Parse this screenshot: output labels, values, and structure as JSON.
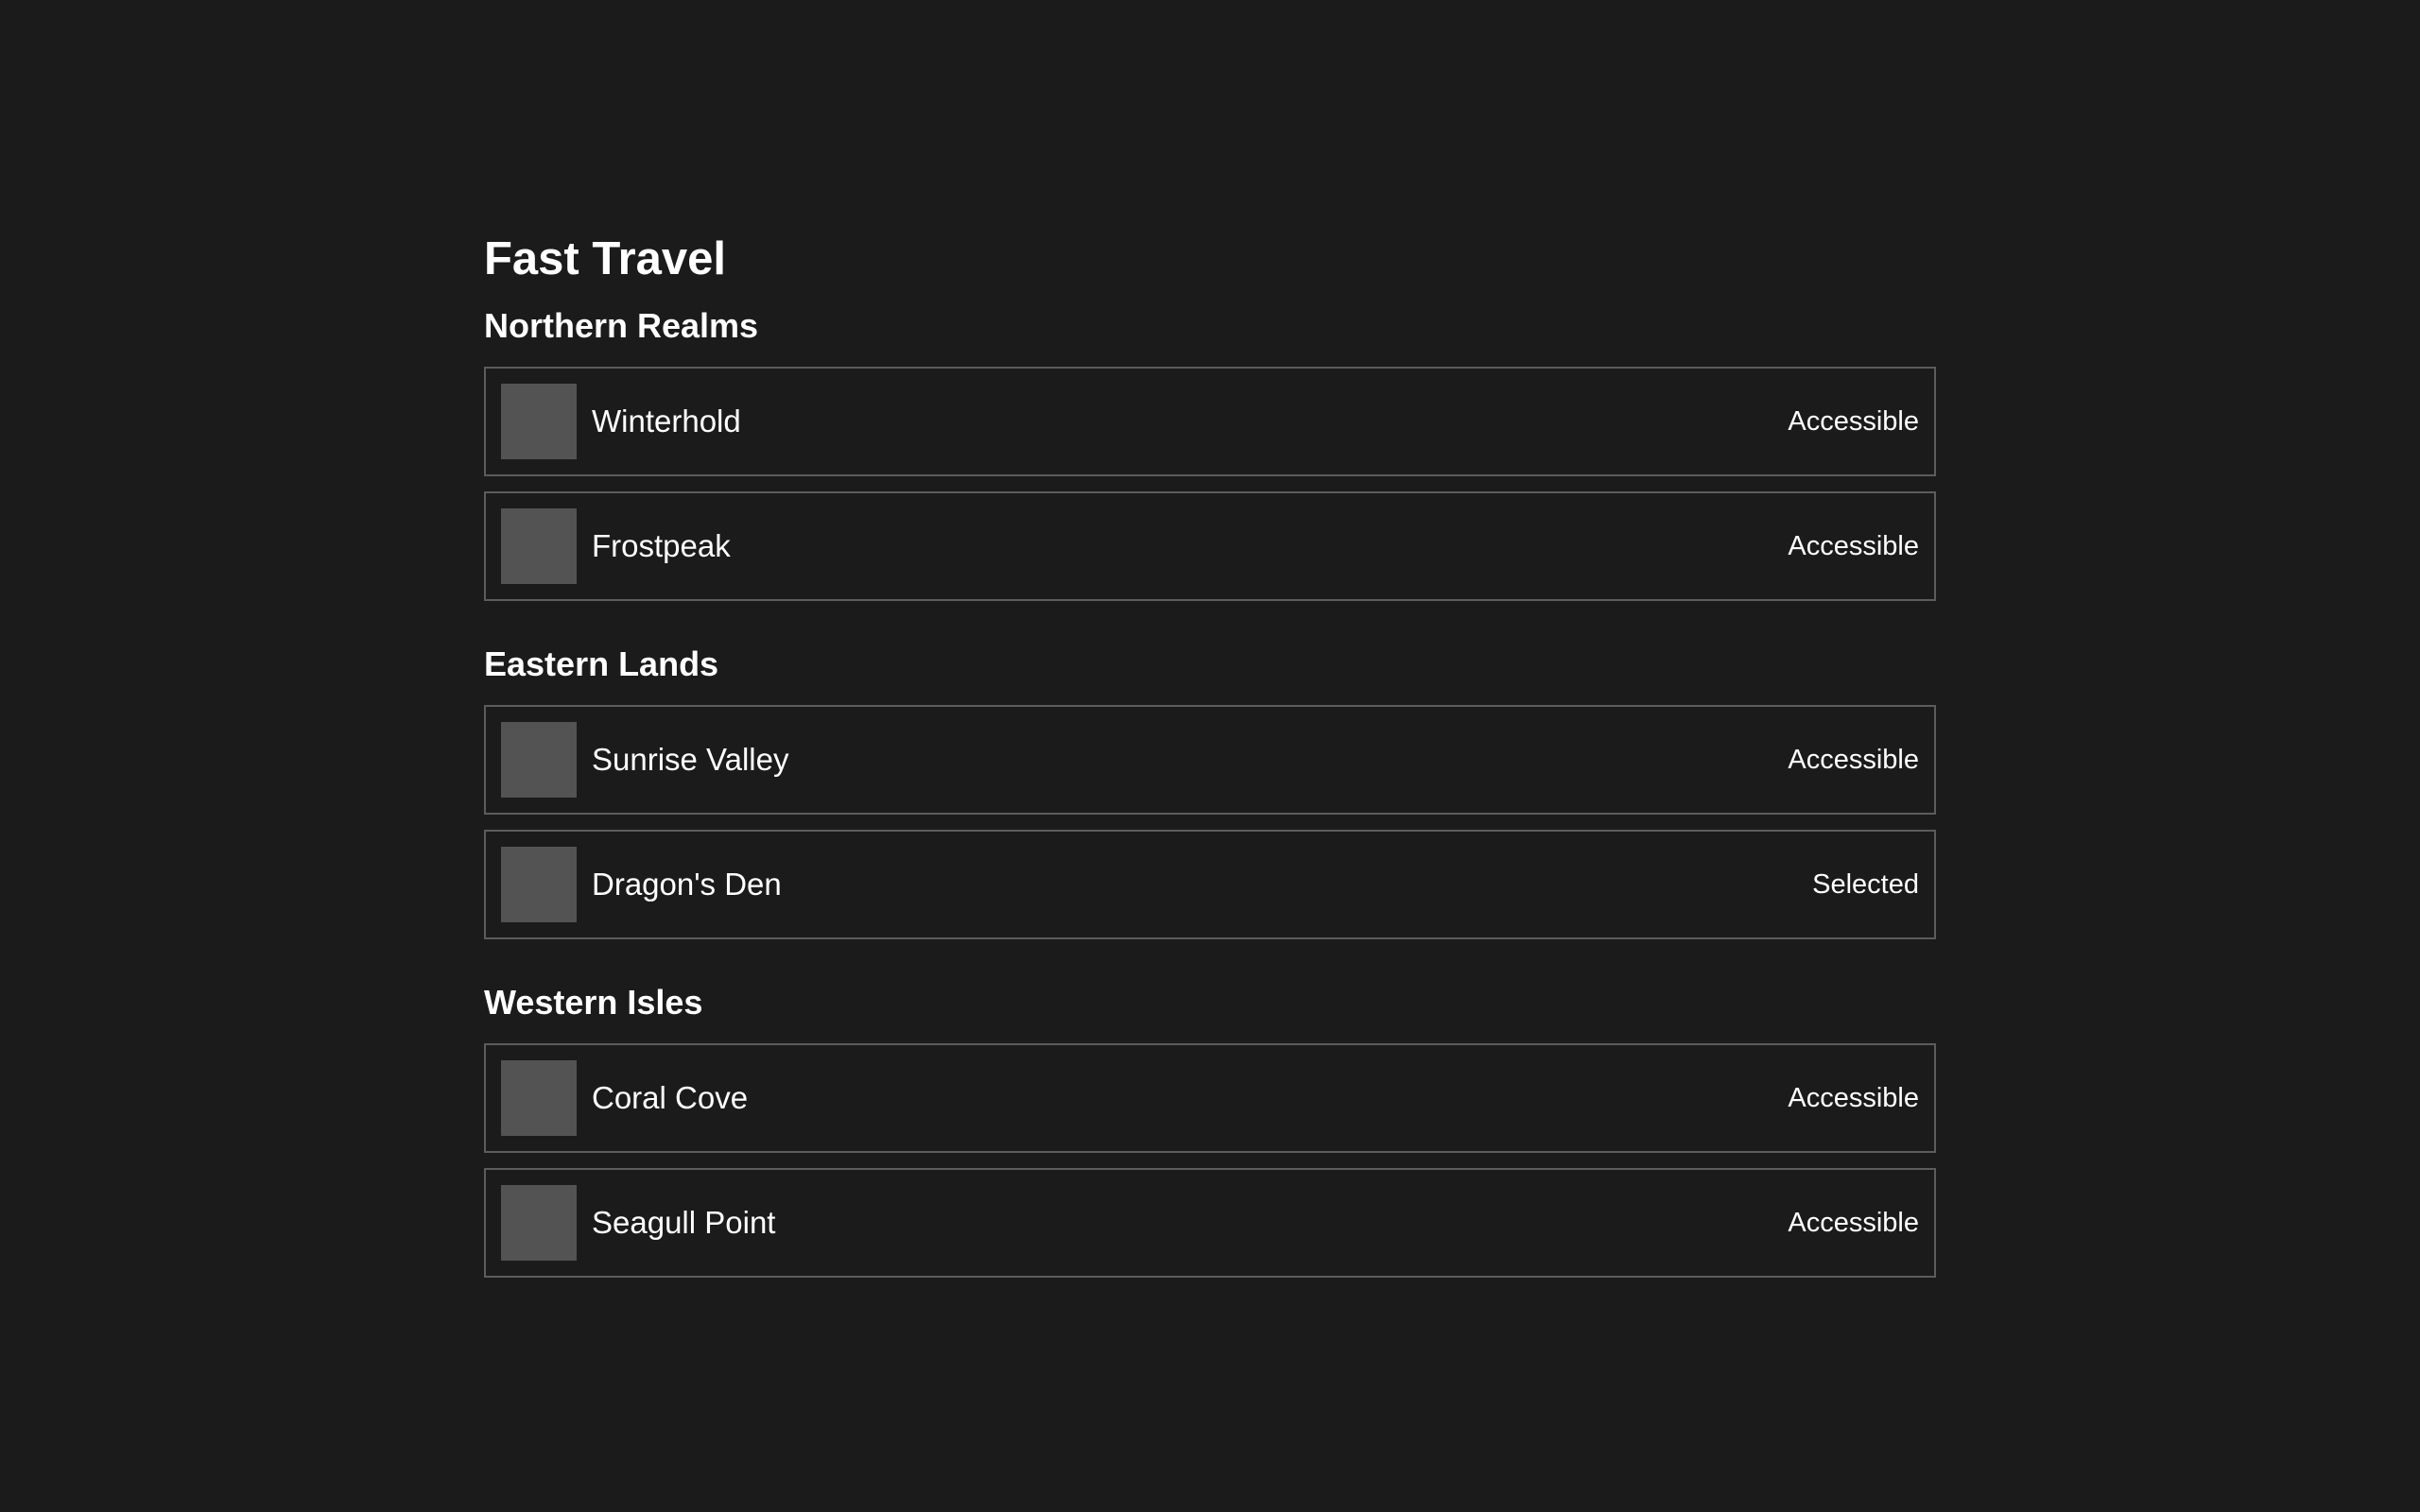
{
  "title": "Fast Travel",
  "regions": [
    {
      "name": "Northern Realms",
      "locations": [
        {
          "name": "Winterhold",
          "status": "Accessible"
        },
        {
          "name": "Frostpeak",
          "status": "Accessible"
        }
      ]
    },
    {
      "name": "Eastern Lands",
      "locations": [
        {
          "name": "Sunrise Valley",
          "status": "Accessible"
        },
        {
          "name": "Dragon's Den",
          "status": "Selected"
        }
      ]
    },
    {
      "name": "Western Isles",
      "locations": [
        {
          "name": "Coral Cove",
          "status": "Accessible"
        },
        {
          "name": "Seagull Point",
          "status": "Accessible"
        }
      ]
    }
  ]
}
